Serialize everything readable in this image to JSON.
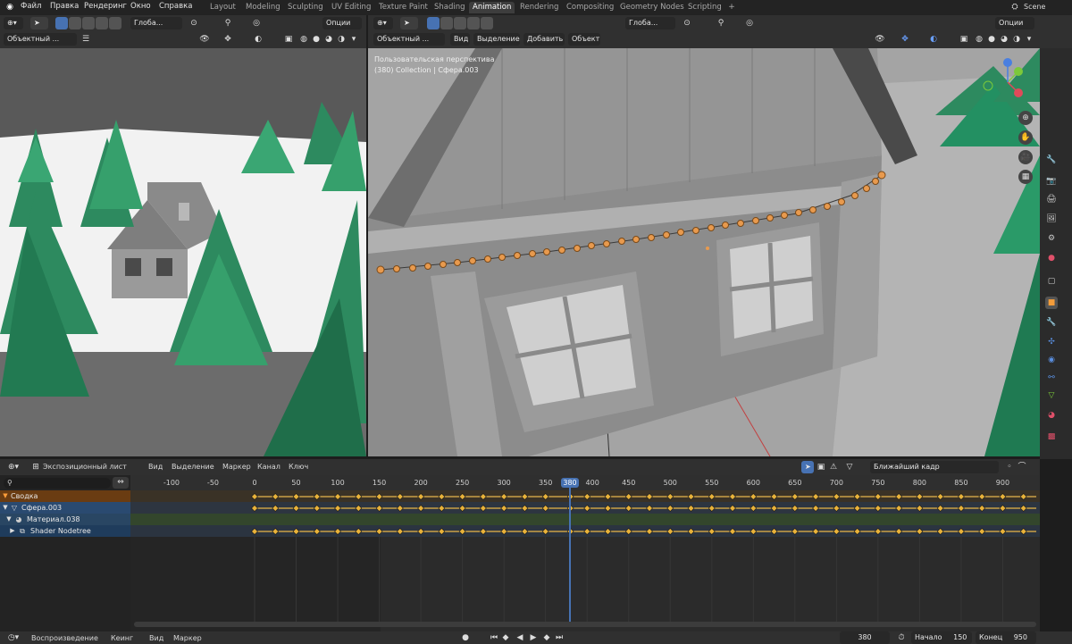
{
  "menu": [
    "Файл",
    "Правка",
    "Рендеринг",
    "Окно",
    "Справка"
  ],
  "workspaces": [
    "Layout",
    "Modeling",
    "Sculpting",
    "UV Editing",
    "Texture Paint",
    "Shading",
    "Animation",
    "Rendering",
    "Compositing",
    "Geometry Nodes",
    "Scripting"
  ],
  "active_workspace": "Animation",
  "scene_name": "Scene",
  "left_view": {
    "orientation": "Глоба...",
    "options": "Опции",
    "mode": "Объектный ..."
  },
  "main_view": {
    "orientation": "Глоба...",
    "options": "Опции",
    "mode": "Объектный ...",
    "menus": [
      "Вид",
      "Выделение",
      "Добавить",
      "Объект"
    ],
    "overlay_title": "Пользовательская перспектива",
    "overlay_subtitle": "(380) Collection | Сфера.003"
  },
  "dopesheet": {
    "editor_mode": "Экспозиционный лист",
    "menus": [
      "Вид",
      "Выделение",
      "Маркер",
      "Канал",
      "Ключ"
    ],
    "snap": "Ближайший кадр",
    "current_frame_badge": "380",
    "ruler": [
      -100,
      -50,
      0,
      50,
      100,
      150,
      200,
      250,
      300,
      350,
      400,
      450,
      500,
      550,
      600,
      650,
      700,
      750,
      800,
      850,
      900
    ],
    "channels": [
      "Сводка",
      "Сфера.003",
      "Материал.038",
      "Shader Nodetree"
    ],
    "keyframes": [
      0,
      25,
      50,
      75,
      100,
      125,
      150,
      175,
      200,
      225,
      250,
      275,
      300,
      325,
      350,
      380,
      400,
      425,
      450,
      475,
      500,
      525,
      550,
      575,
      600,
      625,
      650,
      675,
      700,
      725,
      750,
      775,
      800,
      825,
      850,
      875,
      900,
      925
    ]
  },
  "playback": {
    "menus": [
      "Воспроизведение",
      "Кеинг",
      "Вид",
      "Маркер"
    ],
    "current_frame": "380",
    "start_label": "Начало",
    "start_value": "150",
    "end_label": "Конец",
    "end_value": "950"
  }
}
